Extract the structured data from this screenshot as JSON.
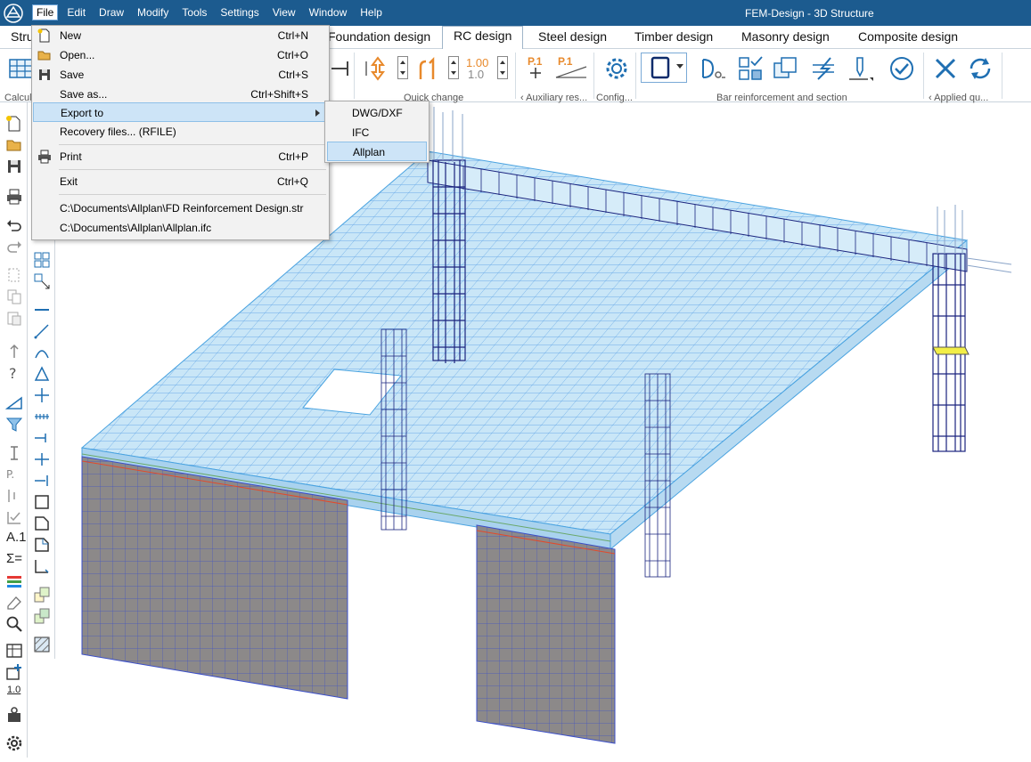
{
  "title_bar": {
    "app_title": "FEM-Design - 3D Structure",
    "menus": [
      "File",
      "Edit",
      "Draw",
      "Modify",
      "Tools",
      "Settings",
      "View",
      "Window",
      "Help"
    ]
  },
  "tabs": [
    "Stru",
    "Foundation design",
    "RC design",
    "Steel design",
    "Timber design",
    "Masonry design",
    "Composite design"
  ],
  "ribbon": {
    "left_group": "Calcul",
    "groups": {
      "quick_change": "Quick change",
      "auxiliary": "Auxiliary res...",
      "config": "Config...",
      "bar_reinforcement": "Bar reinforcement and section",
      "applied": "Applied qu..."
    },
    "value_top": "1.00",
    "value_bottom": "1.0",
    "p1_a": "P.1",
    "p1_b": "P.1"
  },
  "file_menu": {
    "items": [
      {
        "label": "New",
        "shortcut": "Ctrl+N"
      },
      {
        "label": "Open...",
        "shortcut": "Ctrl+O"
      },
      {
        "label": "Save",
        "shortcut": "Ctrl+S"
      },
      {
        "label": "Save as...",
        "shortcut": "Ctrl+Shift+S"
      },
      {
        "label": "Export to",
        "shortcut": ""
      },
      {
        "label": "Recovery files... (RFILE)",
        "shortcut": ""
      },
      {
        "label": "Print",
        "shortcut": "Ctrl+P"
      },
      {
        "label": "Exit",
        "shortcut": "Ctrl+Q"
      }
    ],
    "recent": [
      "C:\\Documents\\Allplan\\FD Reinforcement Design.str",
      "C:\\Documents\\Allplan\\Allplan.ifc"
    ]
  },
  "export_submenu": [
    "DWG/DXF",
    "IFC",
    "Allplan"
  ],
  "left_toolbar": {
    "label_a1": "A.1",
    "label_10": "1.0",
    "label_sum": "Σ="
  },
  "colors": {
    "title_bar": "#1c5b8f",
    "highlight": "#cde4f7",
    "rebar": "#1a237e",
    "slab_mesh": "#4aa3e0",
    "wall": "#8c8989"
  }
}
